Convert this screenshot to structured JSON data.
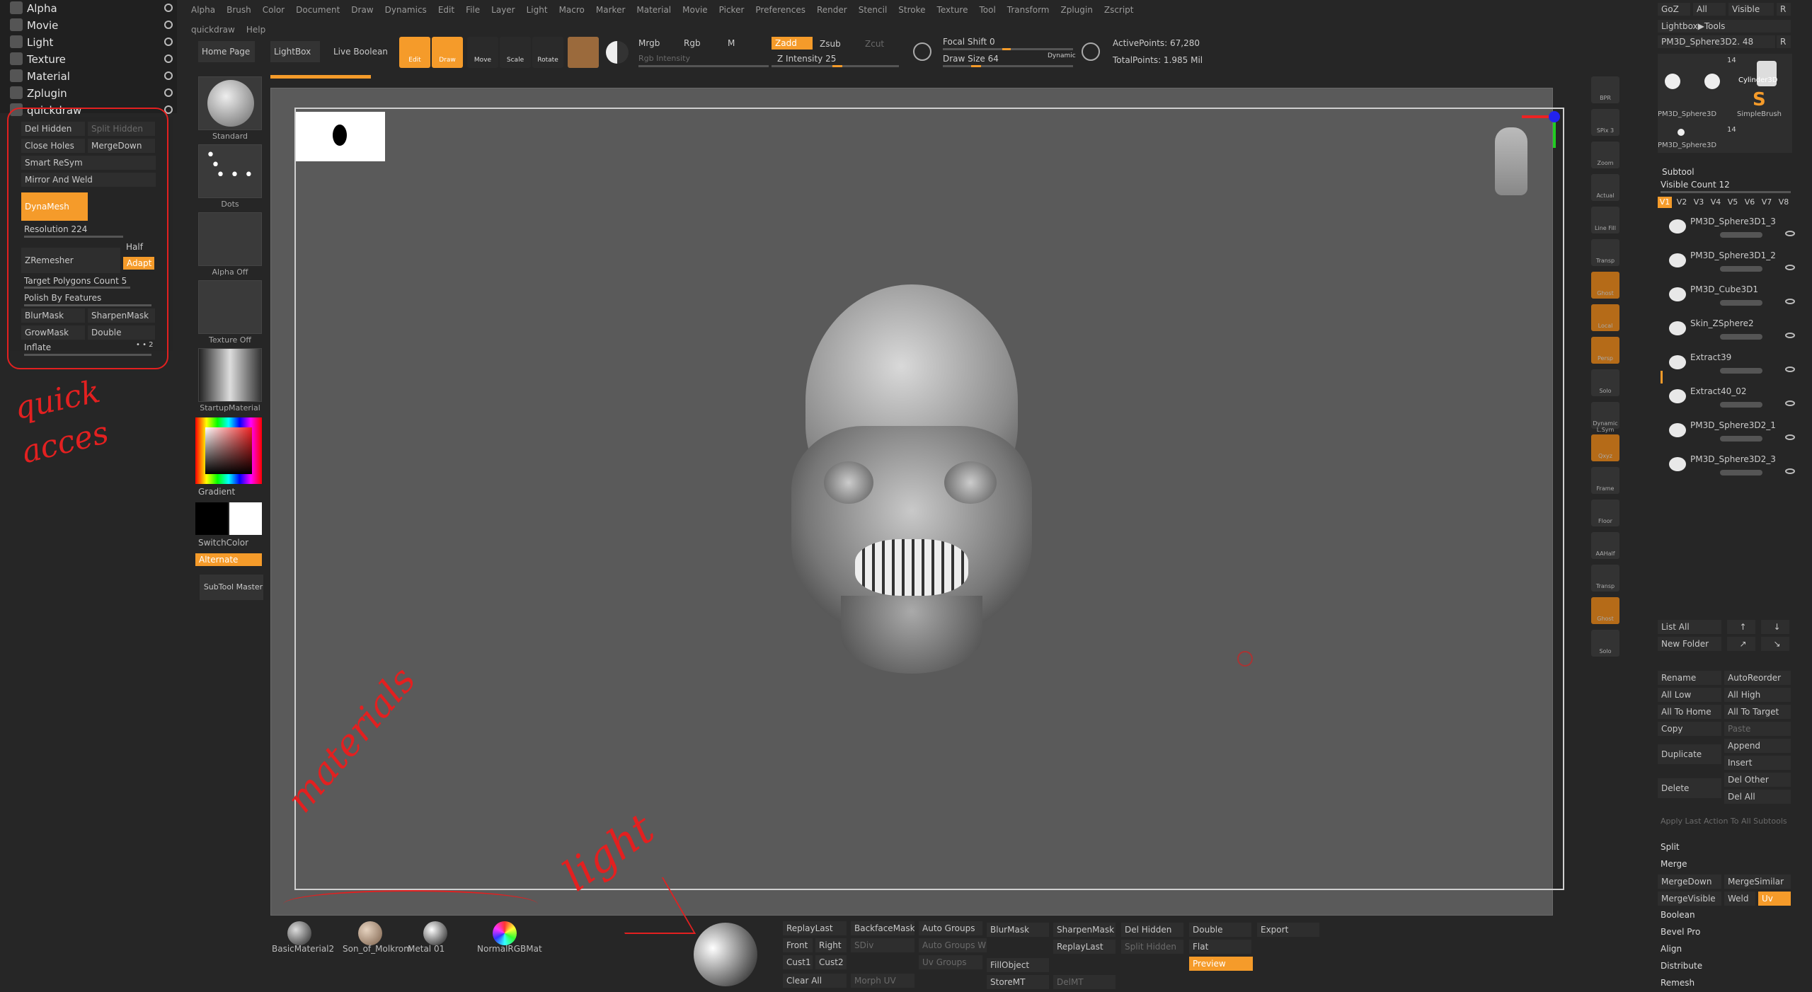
{
  "menu": [
    "Alpha",
    "Brush",
    "Color",
    "Document",
    "Draw",
    "Dynamics",
    "Edit",
    "File",
    "Layer",
    "Light",
    "Macro",
    "Marker",
    "Material",
    "Movie",
    "Picker",
    "Preferences",
    "Render",
    "Stencil",
    "Stroke",
    "Texture",
    "Tool",
    "Transform",
    "Zplugin",
    "Zscript",
    "quickdraw",
    "Help"
  ],
  "palettes": [
    "Alpha",
    "Movie",
    "Light",
    "Texture",
    "Material",
    "Zplugin",
    "quickdraw"
  ],
  "quickdraw": {
    "del_hidden": "Del Hidden",
    "split_hidden": "Split Hidden",
    "close_holes": "Close Holes",
    "merge_down": "MergeDown",
    "smart_resym": "Smart ReSym",
    "mirror_weld": "Mirror And Weld",
    "dynamesh": "DynaMesh",
    "resolution": "Resolution 224",
    "zremesher": "ZRemesher",
    "half": "Half",
    "adapt": "Adapt",
    "target_poly": "Target Polygons Count 5",
    "polish": "Polish By Features",
    "blurmask": "BlurMask",
    "sharpenmask": "SharpenMask",
    "growmask": "GrowMask",
    "double": "Double",
    "inflate": "Inflate",
    "inflate_marker": "• • 2"
  },
  "annotations": {
    "quick": "quick",
    "access": "acces",
    "materials": "materials",
    "light": "light"
  },
  "top": {
    "home": "Home Page",
    "lightbox": "LightBox",
    "live_boolean": "Live Boolean",
    "edit": "Edit",
    "draw": "Draw",
    "move": "Move",
    "scale": "Scale",
    "rotate": "Rotate",
    "mrgb": "Mrgb",
    "rgb": "Rgb",
    "m": "M",
    "rgb_intensity": "Rgb Intensity",
    "zadd": "Zadd",
    "zsub": "Zsub",
    "zcut": "Zcut",
    "z_intensity": "Z Intensity 25",
    "focal_shift": "Focal Shift 0",
    "draw_size": "Draw Size 64",
    "dynamic": "Dynamic",
    "active_points": "ActivePoints: 67,280",
    "total_points": "TotalPoints: 1.985 Mil"
  },
  "shelf": {
    "brush": "Standard",
    "stroke": "Dots",
    "alpha": "Alpha Off",
    "texture": "Texture Off",
    "material": "StartupMaterial",
    "gradient": "Gradient",
    "switch_color": "SwitchColor",
    "alternate": "Alternate",
    "subtool_master": "SubTool Master"
  },
  "right_view": [
    "BPR",
    "SPix 3",
    "Zoom",
    "Actual",
    "Line Fill",
    "Transp",
    "Ghost",
    "Local",
    "Persp",
    "Solo",
    "Dynamic L.Sym",
    "Qxyz",
    "Frame",
    "Floor",
    "AAHalf",
    "Transp",
    "Ghost",
    "Solo"
  ],
  "tool": {
    "goz": "GoZ",
    "all": "All",
    "visible": "Visible",
    "r": "R",
    "lightbox_tools": "Lightbox▶Tools",
    "current": "PM3D_Sphere3D2. 48",
    "r2": "R",
    "thumbs": [
      "PM3D_Sphere3D",
      "Cylinder3D",
      "SimpleBrush",
      "PM3D_Sphere3D"
    ],
    "thumb_count": "14",
    "thumb_count2": "14"
  },
  "subtool": {
    "title": "Subtool",
    "visible_count": "Visible Count 12",
    "versions": [
      "V1",
      "V2",
      "V3",
      "V4",
      "V5",
      "V6",
      "V7",
      "V8"
    ],
    "items": [
      "PM3D_Sphere3D1_3",
      "PM3D_Sphere3D1_2",
      "PM3D_Cube3D1",
      "Skin_ZSphere2",
      "Extract39",
      "Extract40_02",
      "PM3D_Sphere3D2_1",
      "PM3D_Sphere3D2_3"
    ],
    "list_all": "List All",
    "new_folder": "New Folder",
    "rename": "Rename",
    "autoreorder": "AutoReorder",
    "all_low": "All Low",
    "all_high": "All High",
    "all_to_home": "All To Home",
    "all_to_target": "All To Target",
    "copy": "Copy",
    "paste": "Paste",
    "append": "Append",
    "duplicate": "Duplicate",
    "insert": "Insert",
    "delete": "Delete",
    "del_other": "Del Other",
    "del_all": "Del All",
    "apply_last": "Apply Last Action To All Subtools",
    "split": "Split",
    "merge": "Merge",
    "mergedown": "MergeDown",
    "mergesimilar": "MergeSimilar",
    "mergevisible": "MergeVisible",
    "weld": "Weld",
    "uv": "Uv",
    "boolean": "Boolean",
    "bevel_pro": "Bevel Pro",
    "align": "Align",
    "distribute": "Distribute",
    "remesh": "Remesh"
  },
  "materials": [
    "BasicMaterial2",
    "Son_of_Molkrom",
    "Metal 01",
    "NormalRGBMat"
  ],
  "bottom": {
    "replaylast": "ReplayLast",
    "backfacemask": "BackfaceMask",
    "autogroups": "Auto Groups",
    "blurmask": "BlurMask",
    "sharpenmask": "SharpenMask",
    "del_hidden": "Del Hidden",
    "double": "Double",
    "export": "Export",
    "front": "Front",
    "right": "Right",
    "sdiv": "SDiv",
    "autogroups_uv": "Auto Groups With UV",
    "replaylast2": "ReplayLast",
    "split_hidden": "Split Hidden",
    "flat": "Flat",
    "cust1": "Cust1",
    "cust2": "Cust2",
    "uv_groups": "Uv Groups",
    "fillobject": "FillObject",
    "preview": "Preview",
    "clear_all": "Clear All",
    "morph_uv": "Morph UV",
    "storemt": "StoreMT",
    "delmt": "DelMT"
  },
  "colors": {
    "accent": "#f59b2a",
    "annotation": "#e32020",
    "canvas": "#5a5a5a",
    "bg": "#262626"
  }
}
